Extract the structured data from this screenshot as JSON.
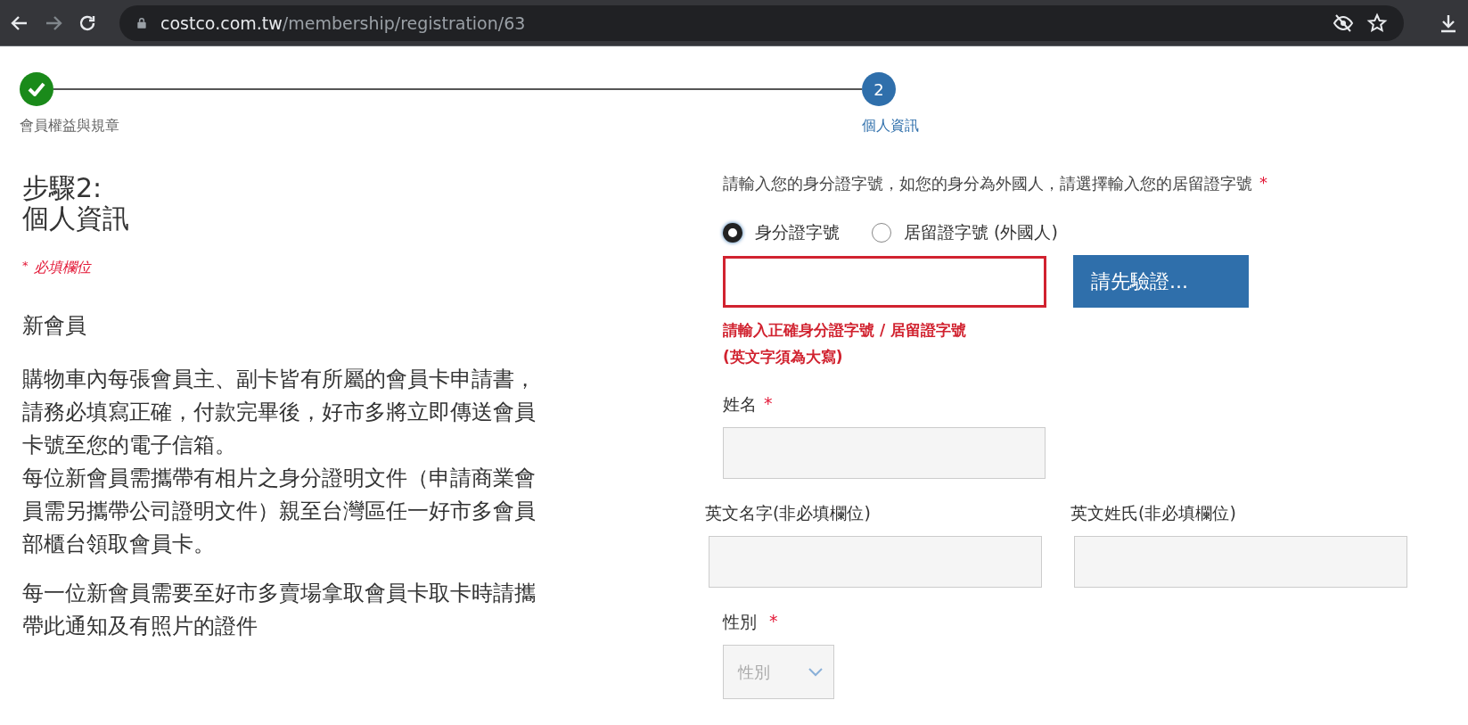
{
  "browser": {
    "url": {
      "domain": "costco.com.tw",
      "path": "/membership/registration/63"
    }
  },
  "steps": [
    {
      "label": "會員權益與規章",
      "completed": true
    },
    {
      "number": "2",
      "label": "個人資訊",
      "completed": false
    }
  ],
  "intro": {
    "title": "步驟2:\n個人資訊",
    "required_note": {
      "mark": "*",
      "text": "必填欄位"
    },
    "section_title": "新會員",
    "paragraphs": [
      [
        "購物車內每張會員主、副卡皆有所屬的會員卡申請書，請務必填寫正確，付款完畢後，好市多將立即傳送會員卡號至您的電子信箱。",
        "每位新會員需攜帶有相片之身分證明文件（申請商業會員需另攜帶公司證明文件）親至台灣區任一好市多會員部櫃台領取會員卡。"
      ],
      [
        "每一位新會員需要至好市多賣場拿取會員卡取卡時請攜帶此通知及有照片的證件"
      ]
    ]
  },
  "id_section": {
    "prompt": "請輸入您的身分證字號，如您的身分為外國人，請選擇輸入您的居留證字號",
    "required_mark": "*",
    "options": [
      {
        "label": "身分證字號",
        "selected": true
      },
      {
        "label": "居留證字號 (外國人)",
        "selected": false
      }
    ],
    "input": {
      "invalid": true
    },
    "button": "請先驗證...",
    "error": "請輸入正確身分證字號 / 居留證字號\n(英文字須為大寫)"
  },
  "name_field": {
    "label": "姓名",
    "required_mark": "*"
  },
  "english_fields": [
    {
      "label": "英文名字(非必填欄位)"
    },
    {
      "label": "英文姓氏(非必填欄位)"
    }
  ],
  "gender": {
    "label": "性別",
    "required_mark": "*",
    "placeholder": "性別"
  }
}
